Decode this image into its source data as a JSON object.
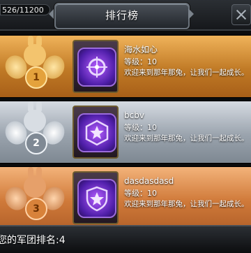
{
  "header": {
    "counter_text": "526/11200",
    "title": "排行榜"
  },
  "rows": [
    {
      "rank": "1",
      "name": "海水如心",
      "level_label": "等级",
      "level_value": "10",
      "message": "欢迎来到那年那兔，让我们一起成长。",
      "medal": "gold"
    },
    {
      "rank": "2",
      "name": "bcbv",
      "level_label": "等级",
      "level_value": "10",
      "message": "欢迎来到那年那兔，让我们一起成长。",
      "medal": "silver"
    },
    {
      "rank": "3",
      "name": "dasdasdasd",
      "level_label": "等级",
      "level_value": "10",
      "message": "欢迎来到那年那兔，让我们一起成长。",
      "medal": "bronze"
    }
  ],
  "footer": {
    "my_rank_text": "您的军团排名:4"
  },
  "colors": {
    "gold": "#e4a23c",
    "silver": "#9aa3ad",
    "bronze": "#d07a3a",
    "emblem_purple": "#7a3cd6"
  }
}
